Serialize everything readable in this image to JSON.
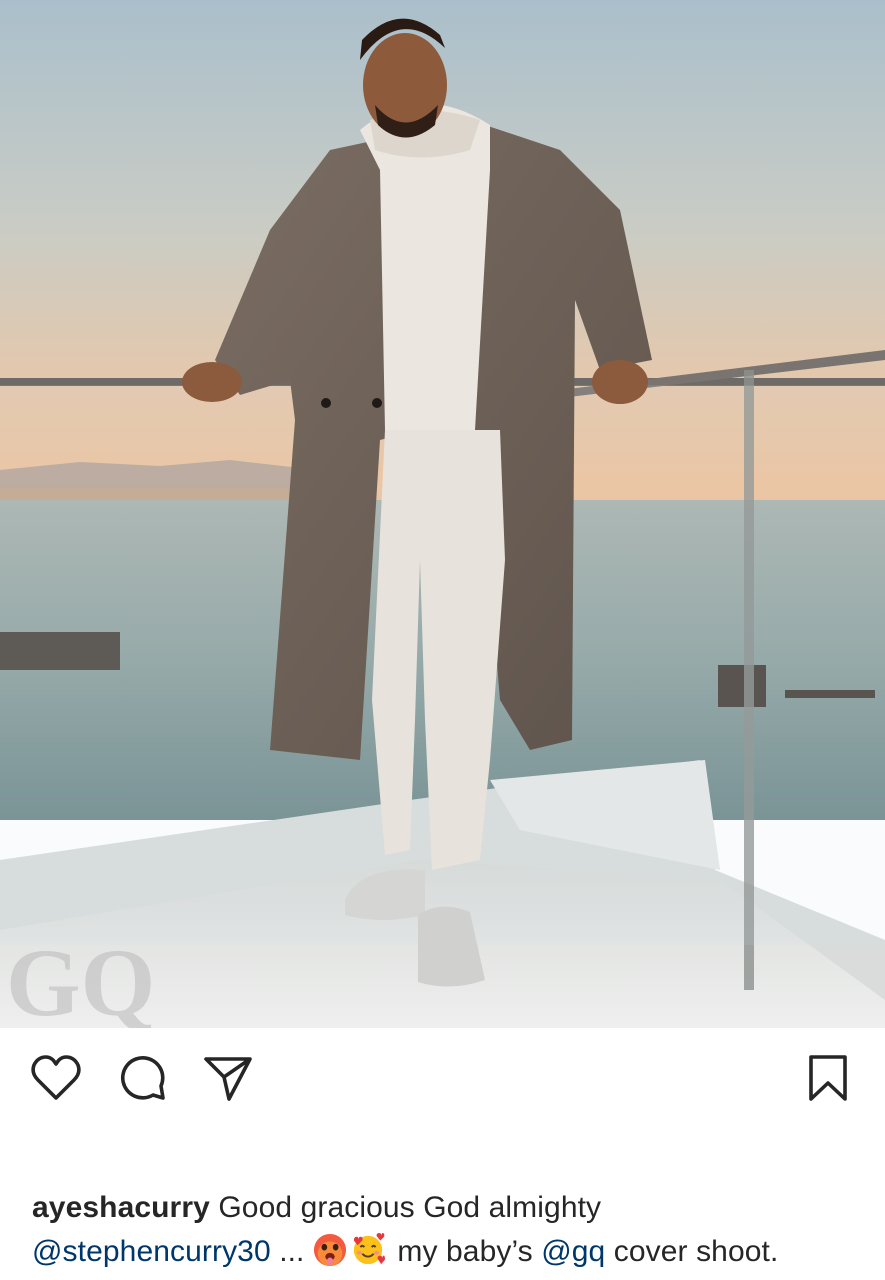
{
  "post": {
    "watermark": "GQ"
  },
  "actions": {
    "like_icon": "heart-icon",
    "comment_icon": "comment-icon",
    "share_icon": "send-icon",
    "save_icon": "bookmark-icon"
  },
  "caption": {
    "username": "ayeshacurry",
    "text_line1": "Good gracious God almighty",
    "mention1": "@stephencurry30",
    "ellipsis": "...",
    "emoji1": "hot-face-emoji",
    "emoji2": "smiling-face-with-hearts-emoji",
    "text_mid": "my baby’s",
    "mention2": "@gq",
    "text_end": "cover shoot."
  },
  "colors": {
    "text": "#262626",
    "mention": "#00376b"
  }
}
